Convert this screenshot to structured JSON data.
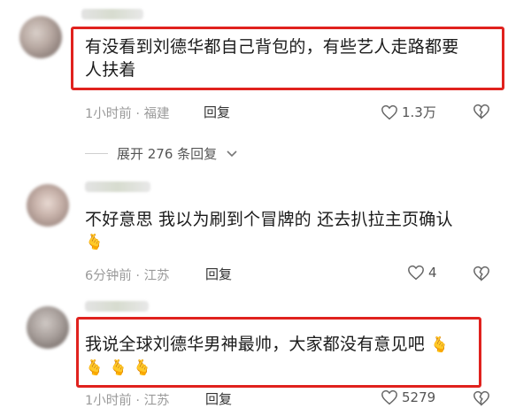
{
  "comments": [
    {
      "text_line1": "有没看到刘德华都自己背包的，有些艺人走路都要",
      "text_line2": "人扶着",
      "time": "1小时前",
      "location": "福建",
      "reply_label": "回复",
      "likes": "1.3万"
    },
    {
      "text": "不好意思 我以为刷到个冒牌的 还去扒拉主页确认",
      "emoji": [
        "🫰"
      ],
      "time": "6分钟前",
      "location": "江苏",
      "reply_label": "回复",
      "likes": "4"
    },
    {
      "text": "我说全球刘德华男神最帅，大家都没有意见吧",
      "emoji": [
        "🫰",
        "🫰",
        "🫰"
      ],
      "trailing_emoji": "🫰",
      "time": "1小时前",
      "location": "江苏",
      "reply_label": "回复",
      "likes": "5279"
    }
  ],
  "expand_replies": {
    "label": "展开 276 条回复"
  },
  "colors": {
    "highlight": "#e0221e",
    "meta_text": "#9a9a9a"
  }
}
